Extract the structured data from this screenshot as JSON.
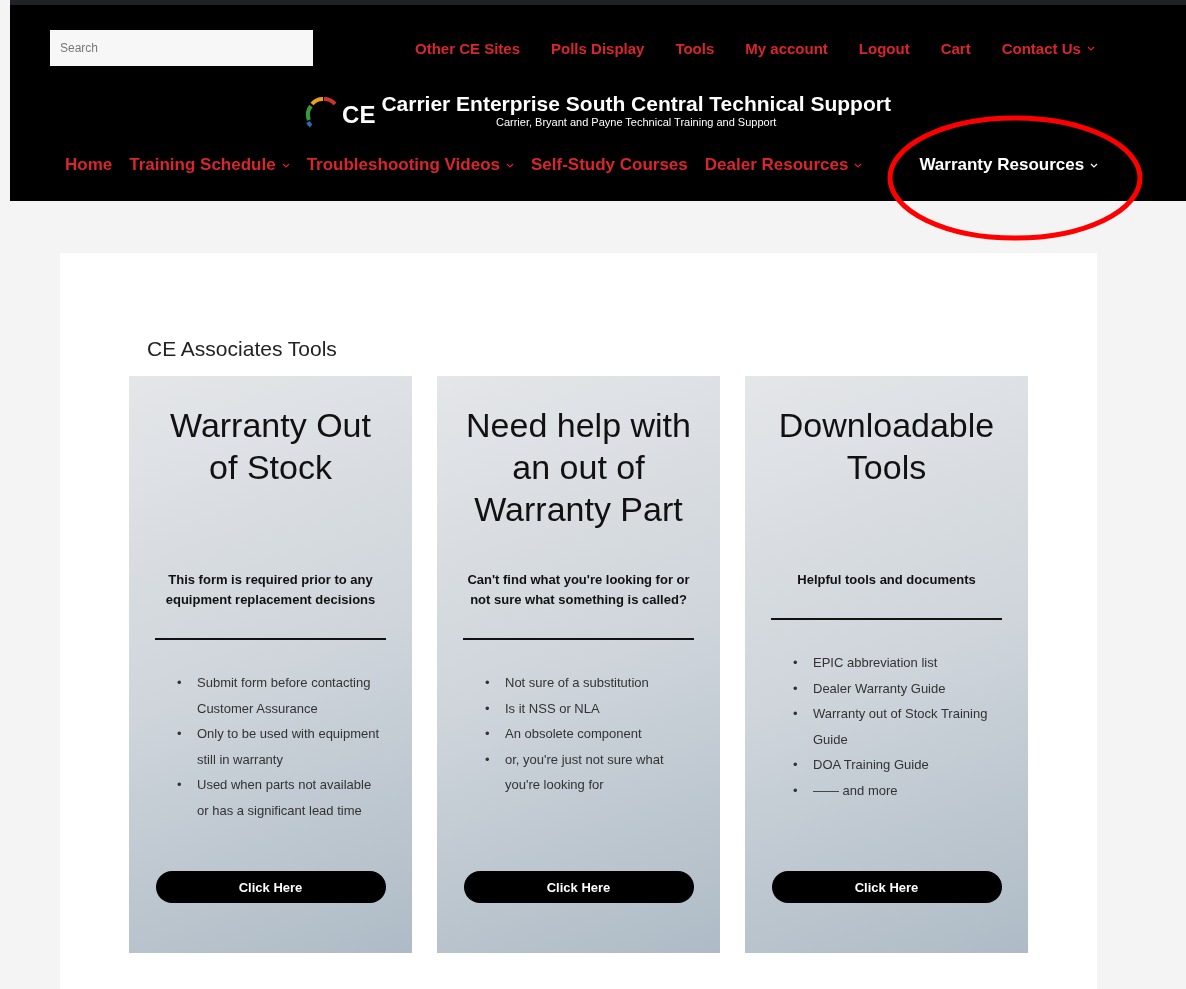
{
  "search": {
    "placeholder": "Search"
  },
  "top_links": [
    {
      "label": "Other CE Sites",
      "has_menu": false
    },
    {
      "label": "Polls Display",
      "has_menu": false
    },
    {
      "label": "Tools",
      "has_menu": false
    },
    {
      "label": "My account",
      "has_menu": false
    },
    {
      "label": "Logout",
      "has_menu": false
    },
    {
      "label": "Cart",
      "has_menu": false
    },
    {
      "label": "Contact Us",
      "has_menu": true
    }
  ],
  "brand": {
    "logo": "CE",
    "title": "Carrier Enterprise South Central Technical Support",
    "subtitle": "Carrier, Bryant and Payne Technical Training and Support"
  },
  "nav": [
    {
      "label": "Home",
      "has_menu": false,
      "selected": false
    },
    {
      "label": "Training Schedule",
      "has_menu": true,
      "selected": false
    },
    {
      "label": "Troubleshooting Videos",
      "has_menu": true,
      "selected": false
    },
    {
      "label": "Self-Study Courses",
      "has_menu": false,
      "selected": false
    },
    {
      "label": "Dealer Resources",
      "has_menu": true,
      "selected": false
    },
    {
      "label": "Warranty Resources",
      "has_menu": true,
      "selected": true
    }
  ],
  "annotation": {
    "kind": "ellipse",
    "color": "#ff0000"
  },
  "section_title": "CE Associates Tools",
  "bullet_marker": "•",
  "cards": [
    {
      "title": "Warranty Out of Stock",
      "intro": "This form is required prior to any equipment replacement decisions",
      "bullets": [
        "Submit form before contacting Customer Assurance",
        "Only to be used with equipment still in warranty",
        "Used when parts not available or has a significant lead time"
      ],
      "button": "Click Here"
    },
    {
      "title": "Need help with an out of Warranty Part",
      "intro": "Can't find what you're looking for or not sure what something is called?",
      "bullets": [
        "Not sure of a substitution",
        "Is it NSS or NLA",
        "An obsolete component",
        "or, you're just not sure what you're looking for"
      ],
      "button": "Click Here"
    },
    {
      "title": "Downloadable Tools",
      "intro": "Helpful tools and documents",
      "bullets": [
        "EPIC abbreviation list",
        "Dealer Warranty Guide",
        "Warranty out of Stock Training Guide",
        "DOA Training Guide",
        "—— and more"
      ],
      "button": "Click Here"
    }
  ]
}
